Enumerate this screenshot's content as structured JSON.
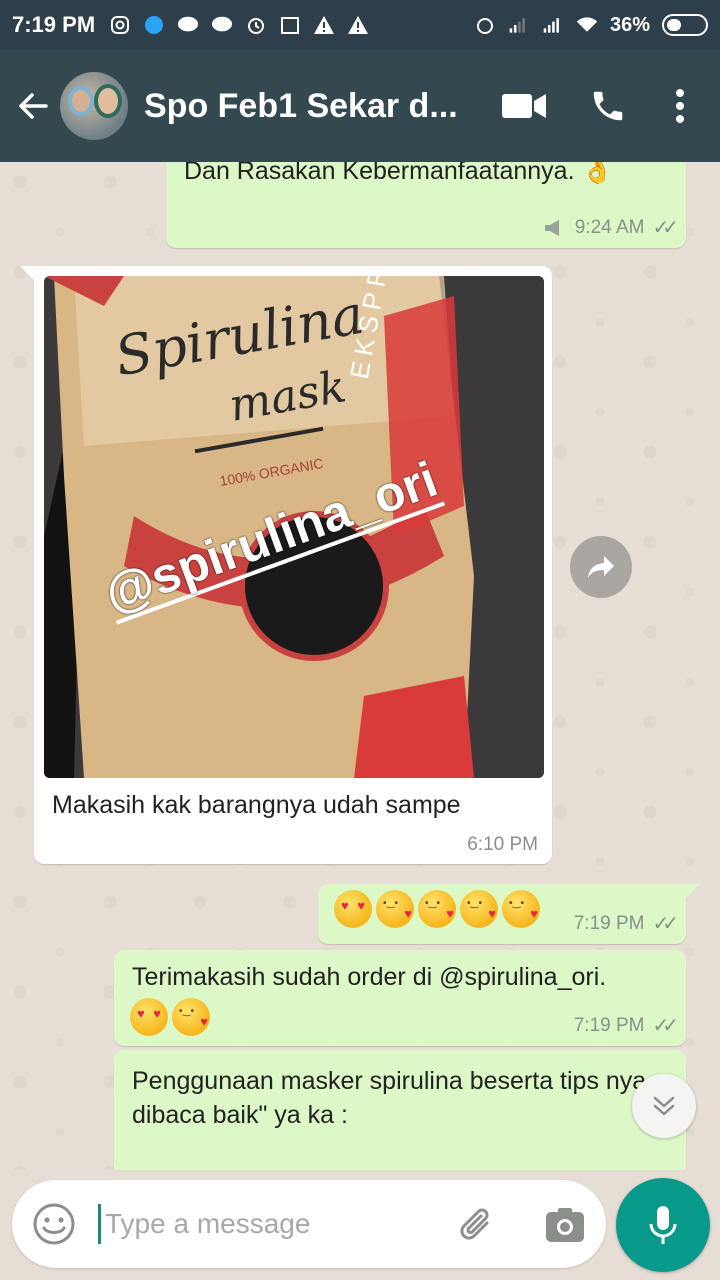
{
  "status_bar": {
    "time": "7:19 PM",
    "battery": "36%"
  },
  "header": {
    "title": "Spo Feb1 Sekar d..."
  },
  "messages": [
    {
      "type": "outgoing",
      "text": "Dan Rasakan Kebermanfaatannya. 👌",
      "time": "9:24 AM"
    },
    {
      "type": "incoming",
      "image_text": [
        "Spirulina",
        "mask",
        "100% ORGANIC",
        "EKSPRES",
        "@spirulina_ori"
      ],
      "caption": "Makasih kak barangnya udah sampe",
      "time": "6:10 PM"
    },
    {
      "type": "outgoing",
      "emojis": "😍😘😘😘😘",
      "time": "7:19 PM"
    },
    {
      "type": "outgoing",
      "text": "Terimakasih sudah order di @spirulina_ori.",
      "emojis": "😍😘",
      "time": "7:19 PM"
    },
    {
      "type": "outgoing",
      "text": "Penggunaan masker spirulina beserta tips nya dibaca baik\" ya ka :"
    }
  ],
  "input": {
    "placeholder": "Type a message"
  },
  "colors": {
    "header": "#34484f",
    "outgoing_bubble": "#dcf8c6",
    "incoming_bubble": "#ffffff",
    "fab": "#079a8b"
  }
}
